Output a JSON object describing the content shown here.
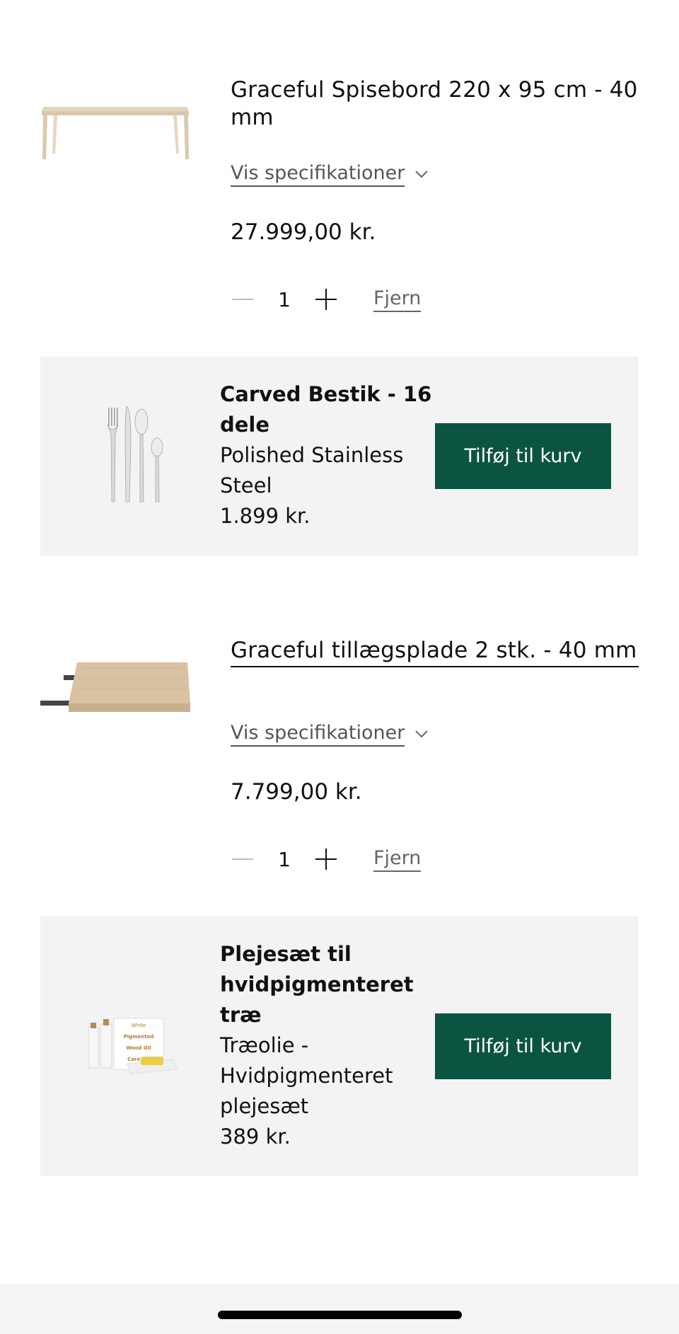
{
  "cart_items": [
    {
      "title": "Graceful Spisebord 220 x 95 cm - 40 mm",
      "spec_toggle": "Vis specifikationer",
      "price": "27.999,00 kr.",
      "quantity": "1",
      "remove_label": "Fjern",
      "image": "dining-table-image"
    },
    {
      "title": "Graceful tillægsplade 2 stk. - 40 mm",
      "spec_toggle": "Vis specifikationer",
      "price": "7.799,00 kr.",
      "quantity": "1",
      "remove_label": "Fjern",
      "image": "extension-leaf-image"
    }
  ],
  "upsells": [
    {
      "name": "Carved Bestik - 16 dele",
      "variant": "Polished Stainless Steel",
      "price": "1.899 kr.",
      "button": "Tilføj til kurv",
      "image": "cutlery-image"
    },
    {
      "name": "Plejesæt til hvidpigmenteret træ",
      "variant": "Træolie - Hvidpigmenteret plejesæt",
      "price": "389 kr.",
      "button": "Tilføj til kurv",
      "image": "care-kit-image",
      "image_text": [
        "White",
        "Pigmented",
        "Wood Oil",
        "Care Kit"
      ]
    }
  ],
  "colors": {
    "accent_button": "#0c5442",
    "upsell_bg": "#f3f3f3",
    "muted_text": "#555555"
  }
}
